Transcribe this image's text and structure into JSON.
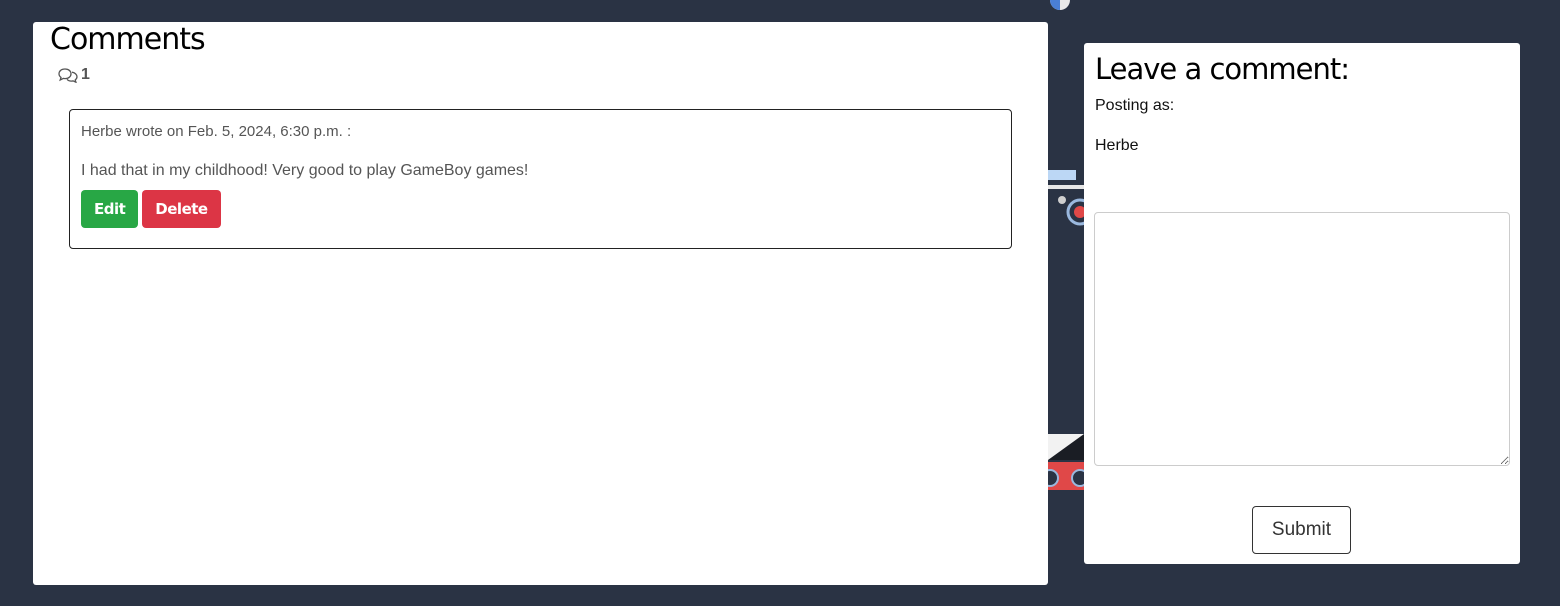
{
  "comments_panel": {
    "title": "Comments",
    "count": "1",
    "comments": [
      {
        "meta": "Herbe wrote on Feb. 5, 2024, 6:30 p.m. :",
        "body": "I had that in my childhood! Very good to play GameBoy games!",
        "edit_label": "Edit",
        "delete_label": "Delete"
      }
    ]
  },
  "form_panel": {
    "title": "Leave a comment:",
    "posting_as_label": "Posting as:",
    "username": "Herbe",
    "textarea_value": "",
    "submit_label": "Submit"
  },
  "colors": {
    "background": "#2a3344",
    "edit_button": "#28a745",
    "delete_button": "#dc3545"
  }
}
